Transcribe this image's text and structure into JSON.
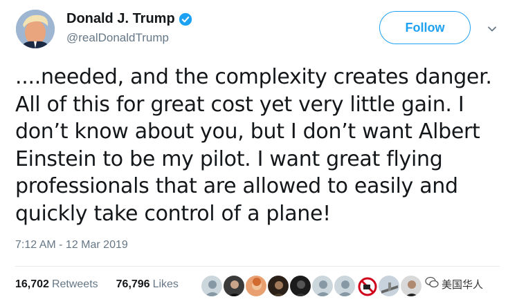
{
  "author": {
    "name": "Donald J. Trump",
    "handle": "@realDonaldTrump",
    "verified_icon": "verified-badge-icon"
  },
  "follow_button": {
    "label": "Follow"
  },
  "menu_icon": "chevron-down-icon",
  "tweet": {
    "text": "....needed, and the complexity creates danger.\nAll of this for great cost yet very little gain. I\ndon’t know about you, but I don’t want Albert\nEinstein to be my pilot. I want great flying\nprofessionals that are allowed to easily and\nquickly take control of a plane!",
    "timestamp": "7:12 AM - 12 Mar 2019"
  },
  "stats": {
    "retweets_count": "16,702",
    "retweets_label": "Retweets",
    "likes_count": "76,796",
    "likes_label": "Likes"
  },
  "watermark": {
    "text": "美国华人"
  },
  "colors": {
    "accent": "#1da1f2",
    "text": "#14171a",
    "secondary": "#657786",
    "divider": "#e6ecf0"
  }
}
